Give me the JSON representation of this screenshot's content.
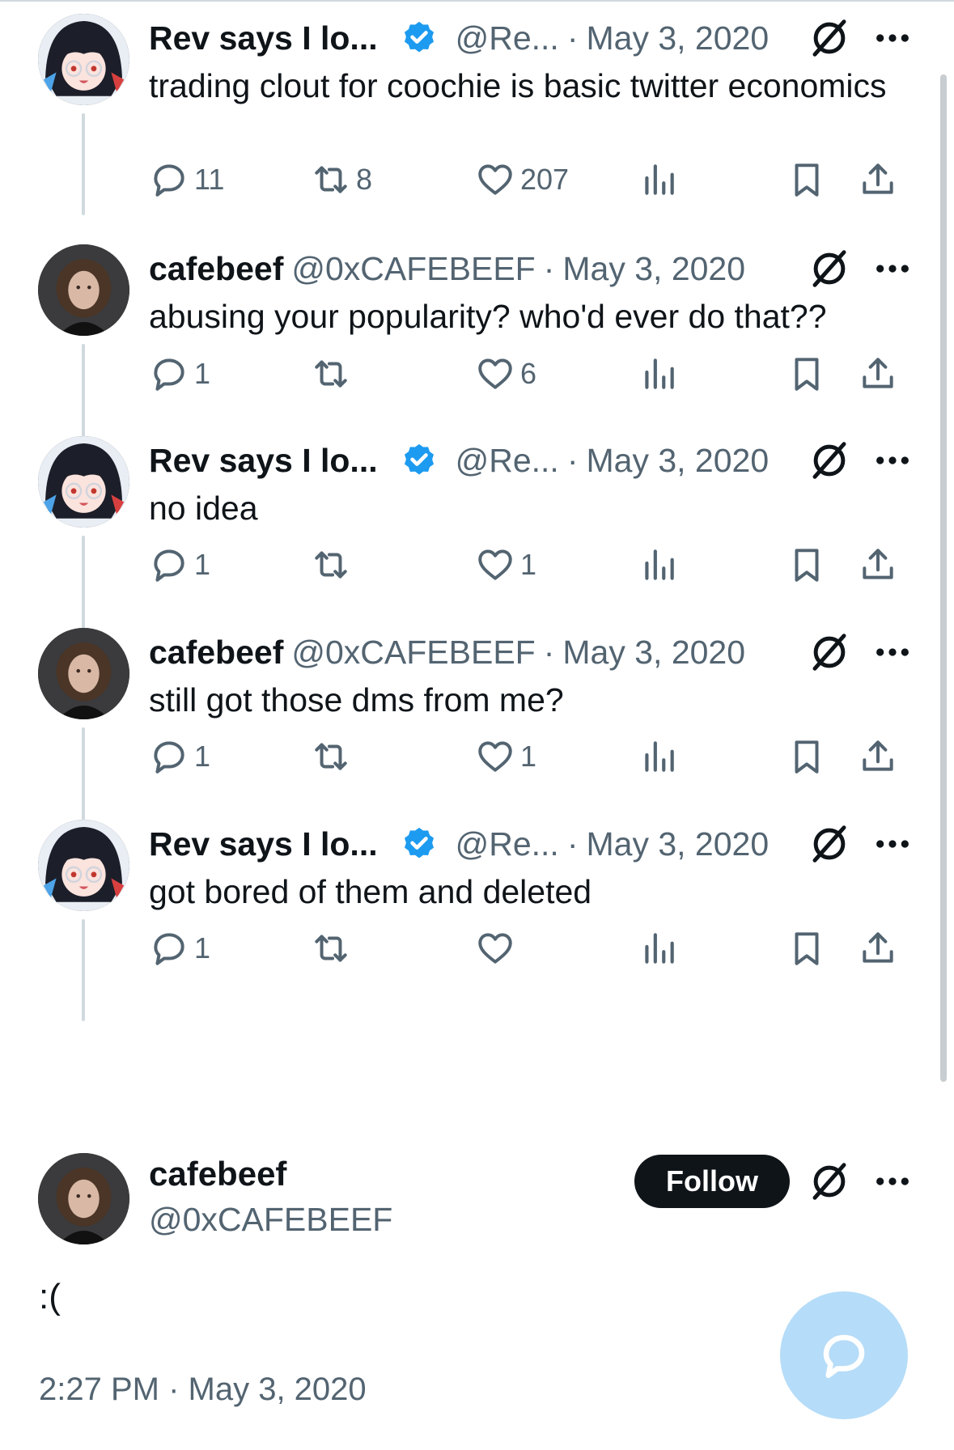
{
  "colors": {
    "text_primary": "#0f1419",
    "text_secondary": "#536471",
    "verified_blue": "#1d9bf0",
    "thread_line": "#cfd9de",
    "follow_bg": "#0f1419",
    "fab_bg": "#b5dcf8"
  },
  "icons": {
    "reply": "reply-icon",
    "retweet": "retweet-icon",
    "like": "heart-icon",
    "views": "views-icon",
    "bookmark": "bookmark-icon",
    "share": "share-icon",
    "grok": "grok-icon",
    "more": "more-icon",
    "verified": "verified-badge-icon",
    "compose": "compose-reply-icon"
  },
  "tweets": [
    {
      "name": "Rev says I lo...",
      "verified": true,
      "handle": "@Re...",
      "separator": "·",
      "date": "May 3, 2020",
      "text": "trading clout for coochie is basic twitter economics",
      "reply_count": "11",
      "retweet_count": "8",
      "like_count": "207"
    },
    {
      "name": "cafebeef",
      "verified": false,
      "handle": "@0xCAFEBEEF",
      "separator": "·",
      "date": "May 3, 2020",
      "text": "abusing your popularity? who'd ever do that??",
      "reply_count": "1",
      "retweet_count": "",
      "like_count": "6"
    },
    {
      "name": "Rev says I lo...",
      "verified": true,
      "handle": "@Re...",
      "separator": "·",
      "date": "May 3, 2020",
      "text": "no idea",
      "reply_count": "1",
      "retweet_count": "",
      "like_count": "1"
    },
    {
      "name": "cafebeef",
      "verified": false,
      "handle": "@0xCAFEBEEF",
      "separator": "·",
      "date": "May 3, 2020",
      "text": "still got those dms from me?",
      "reply_count": "1",
      "retweet_count": "",
      "like_count": "1"
    },
    {
      "name": "Rev says I lo...",
      "verified": true,
      "handle": "@Re...",
      "separator": "·",
      "date": "May 3, 2020",
      "text": "got bored of them and deleted",
      "reply_count": "1",
      "retweet_count": "",
      "like_count": ""
    }
  ],
  "main_tweet": {
    "name": "cafebeef",
    "handle": "@0xCAFEBEEF",
    "follow_label": "Follow",
    "text": ":(",
    "timestamp": "2:27 PM · May 3, 2020"
  }
}
